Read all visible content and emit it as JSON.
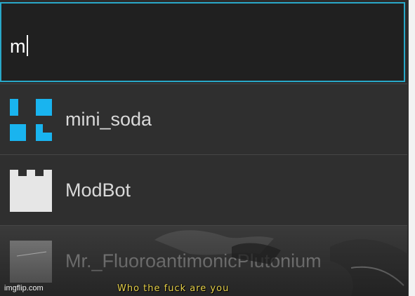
{
  "search": {
    "value": "m"
  },
  "results": [
    {
      "label": "mini_soda",
      "icon": "mini-soda-blocks-icon",
      "icon_color": "#19b4ef"
    },
    {
      "label": "ModBot",
      "icon": "castle-tower-icon",
      "icon_color": "#e6e6e6"
    },
    {
      "label": "Mr._FluoroantimonicPlutonium",
      "icon": "gray-square-avatar-icon",
      "icon_color": "#7d7d7d"
    }
  ],
  "overlay": {
    "watermark": "imgflip.com",
    "caption": "Who the fuck are you"
  },
  "colors": {
    "accent": "#29a8c8",
    "panel": "#2b2b2b",
    "caption": "#e8d24a"
  }
}
